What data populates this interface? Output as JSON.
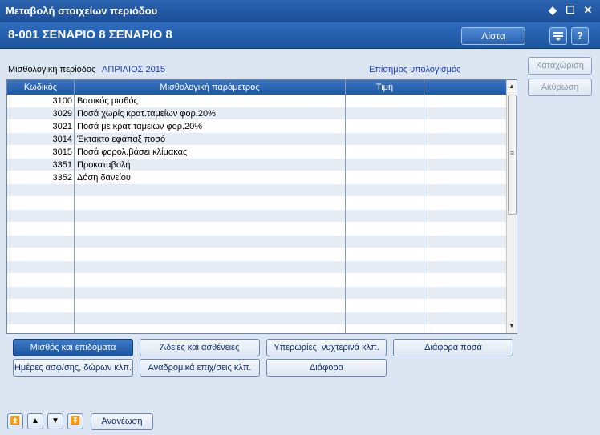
{
  "window": {
    "title": "Μεταβολή στοιχείων περιόδου",
    "controls": [
      "◆",
      "☐",
      "✕"
    ]
  },
  "header": {
    "code_title": "8-001  ΣΕΝΑΡΙΟ 8 ΣΕΝΑΡΙΟ 8",
    "list_label": "Λίστα",
    "filter_icon": "filter-icon",
    "help_label": "?"
  },
  "period": {
    "label": "Μισθολογική περίοδος",
    "value": "ΑΠΡΙΛΙΟΣ 2015",
    "calc_link": "Επίσημος υπολογισμός"
  },
  "side": {
    "save_label": "Καταχώριση",
    "cancel_label": "Ακύρωση"
  },
  "grid": {
    "columns": [
      "Κωδικός",
      "Μισθολογική παράμετρος",
      "Τιμή",
      ""
    ],
    "rows": [
      {
        "code": "3100",
        "name": "Βασικός μισθός"
      },
      {
        "code": "3029",
        "name": "Ποσά χωρίς κρατ.ταμείων φορ.20%"
      },
      {
        "code": "3021",
        "name": "Ποσά με κρατ.ταμείων φορ.20%"
      },
      {
        "code": "3014",
        "name": "Έκτακτο εφάπαξ ποσό"
      },
      {
        "code": "3015",
        "name": "Ποσά φορολ.βάσει κλίμακας"
      },
      {
        "code": "3351",
        "name": "Προκαταβολή"
      },
      {
        "code": "3352",
        "name": "Δόση δανείου"
      }
    ]
  },
  "tabs": {
    "salary": "Μισθός και επιδόματα",
    "leaves": "Άδειες και ασθένειες",
    "overtime": "Υπερωρίες, νυχτερινά κλπ.",
    "misc_amounts": "Διάφορα ποσά",
    "insurance_days": "Ημέρες ασφ/σης, δώρων κλπ.",
    "retroactive": "Αναδρομικά επιχ/σεις κλπ.",
    "misc": "Διάφορα"
  },
  "nav": {
    "first": "⏫",
    "prev": "▲",
    "next": "▼",
    "last": "⏬",
    "refresh_label": "Ανανέωση"
  }
}
